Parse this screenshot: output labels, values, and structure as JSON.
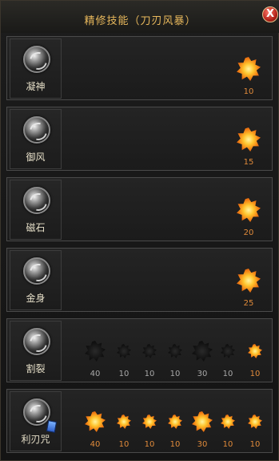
{
  "window": {
    "title": "精修技能（刀刃风暴）",
    "close_label": "X"
  },
  "skills": [
    {
      "name": "凝神",
      "stars": [
        {
          "value": "10",
          "active": true
        }
      ]
    },
    {
      "name": "御风",
      "stars": [
        {
          "value": "15",
          "active": true
        }
      ]
    },
    {
      "name": "磁石",
      "stars": [
        {
          "value": "20",
          "active": true
        }
      ]
    },
    {
      "name": "金身",
      "stars": [
        {
          "value": "25",
          "active": true
        }
      ]
    },
    {
      "name": "割裂",
      "stars": [
        {
          "value": "40",
          "active": false
        },
        {
          "value": "10",
          "active": false
        },
        {
          "value": "10",
          "active": false
        },
        {
          "value": "10",
          "active": false
        },
        {
          "value": "30",
          "active": false
        },
        {
          "value": "10",
          "active": false
        },
        {
          "value": "10",
          "active": true
        }
      ]
    },
    {
      "name": "利刃咒",
      "has_scroll": true,
      "stars": [
        {
          "value": "40",
          "active": true
        },
        {
          "value": "10",
          "active": true
        },
        {
          "value": "10",
          "active": true
        },
        {
          "value": "10",
          "active": true
        },
        {
          "value": "30",
          "active": true
        },
        {
          "value": "10",
          "active": true
        },
        {
          "value": "10",
          "active": true
        }
      ]
    }
  ],
  "colors": {
    "title": "#e8b85c",
    "active_value": "#e08a3a",
    "inactive_value": "#a8a8a8"
  }
}
